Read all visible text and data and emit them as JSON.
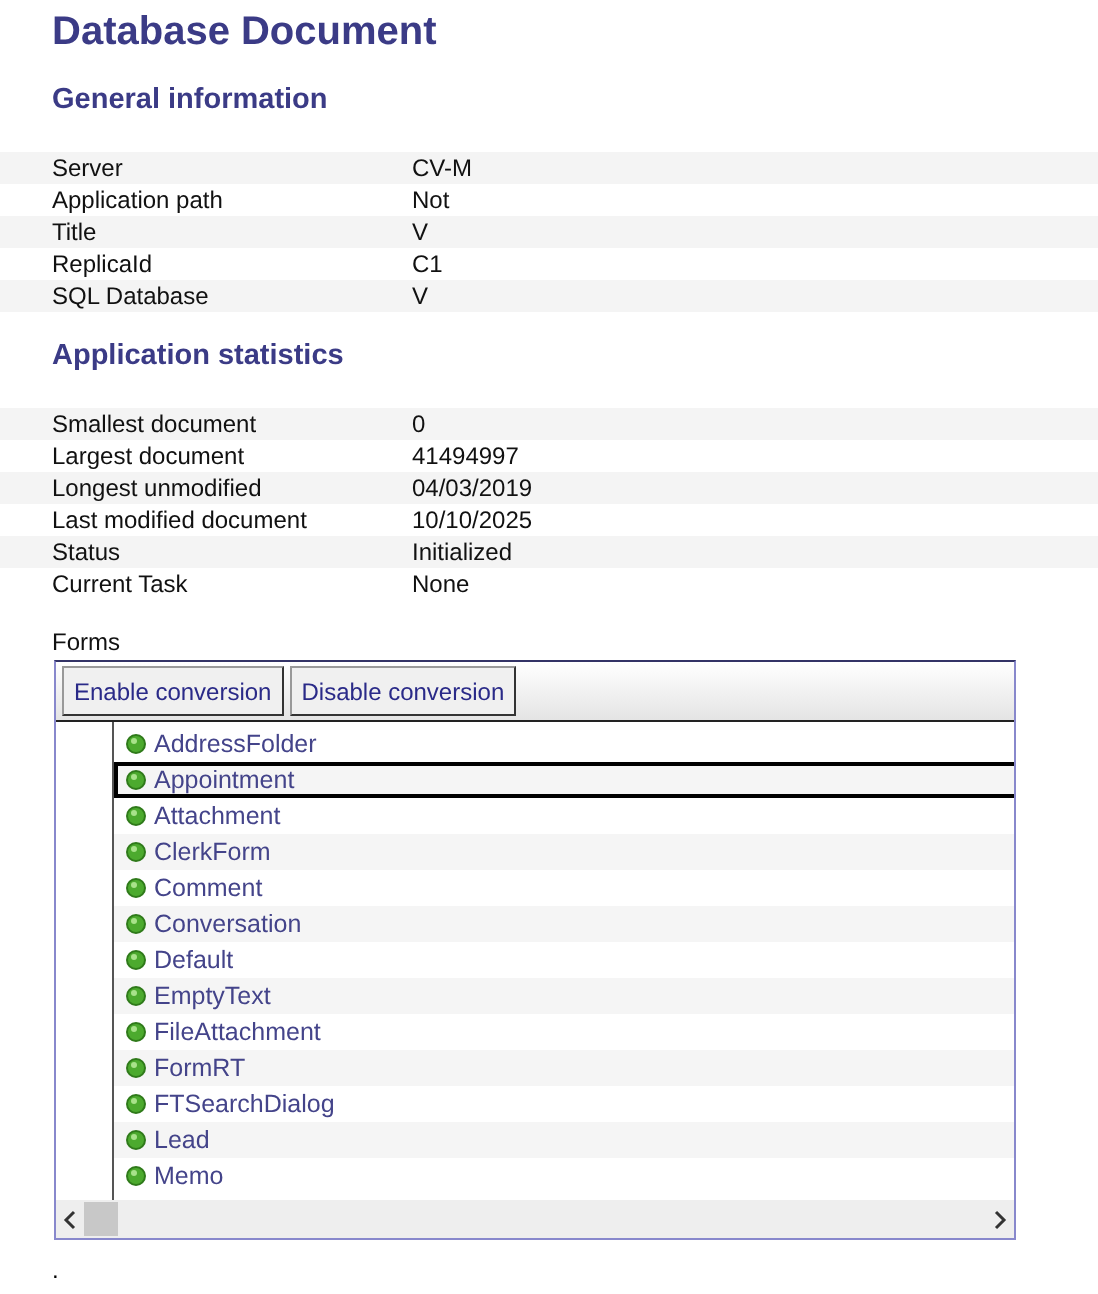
{
  "title": "Database Document",
  "general": {
    "heading": "General information",
    "rows": [
      {
        "label": "Server",
        "value": "CV-M"
      },
      {
        "label": "Application path",
        "value": "Not"
      },
      {
        "label": "Title",
        "value": "V"
      },
      {
        "label": "ReplicaId",
        "value": "C1"
      },
      {
        "label": "SQL Database",
        "value": "V"
      }
    ]
  },
  "statistics": {
    "heading": "Application statistics",
    "rows": [
      {
        "label": "Smallest document",
        "value": "0"
      },
      {
        "label": "Largest document",
        "value": "41494997"
      },
      {
        "label": "Longest unmodified",
        "value": "04/03/2019"
      },
      {
        "label": "Last modified document",
        "value": "10/10/2025"
      },
      {
        "label": "Status",
        "value": "Initialized"
      },
      {
        "label": "Current Task",
        "value": "None"
      }
    ]
  },
  "forms": {
    "label": "Forms",
    "buttons": [
      "Enable conversion",
      "Disable conversion"
    ],
    "items": [
      {
        "name": "AddressFolder",
        "selected": false
      },
      {
        "name": "Appointment",
        "selected": true
      },
      {
        "name": "Attachment",
        "selected": false
      },
      {
        "name": "ClerkForm",
        "selected": false
      },
      {
        "name": "Comment",
        "selected": false
      },
      {
        "name": "Conversation",
        "selected": false
      },
      {
        "name": "Default",
        "selected": false
      },
      {
        "name": "EmptyText",
        "selected": false
      },
      {
        "name": "FileAttachment",
        "selected": false
      },
      {
        "name": "FormRT",
        "selected": false
      },
      {
        "name": "FTSearchDialog",
        "selected": false
      },
      {
        "name": "Lead",
        "selected": false
      },
      {
        "name": "Memo",
        "selected": false
      }
    ]
  },
  "footer": "."
}
